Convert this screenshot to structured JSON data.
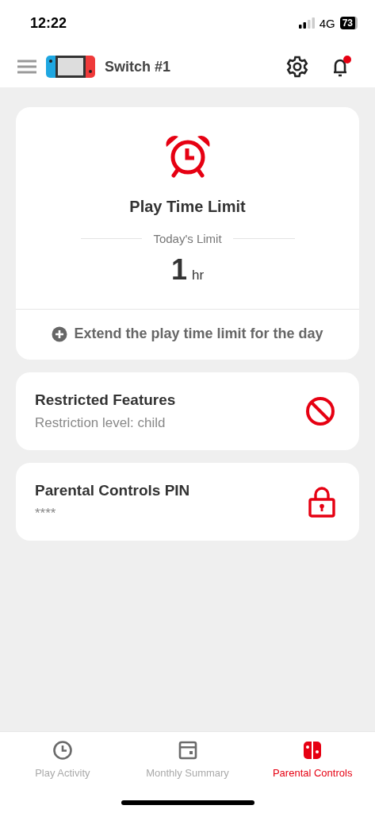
{
  "status_bar": {
    "time": "12:22",
    "network": "4G",
    "battery": "73"
  },
  "header": {
    "title": "Switch #1",
    "notification": true
  },
  "play_time_card": {
    "title": "Play Time Limit",
    "subtitle": "Today's Limit",
    "value": "1",
    "unit": "hr",
    "action": "Extend the play time limit for the day"
  },
  "setting_cards": [
    {
      "kind": "restricted",
      "title": "Restricted Features",
      "detail": "Restriction level: child"
    },
    {
      "kind": "lock",
      "title": "Parental Controls PIN",
      "detail": "****"
    }
  ],
  "tabs": [
    {
      "kind": "clock",
      "label": "Play Activity",
      "selected": false
    },
    {
      "kind": "calendar",
      "label": "Monthly Summary",
      "selected": false
    },
    {
      "kind": "console",
      "label": "Parental Controls",
      "selected": true
    }
  ]
}
